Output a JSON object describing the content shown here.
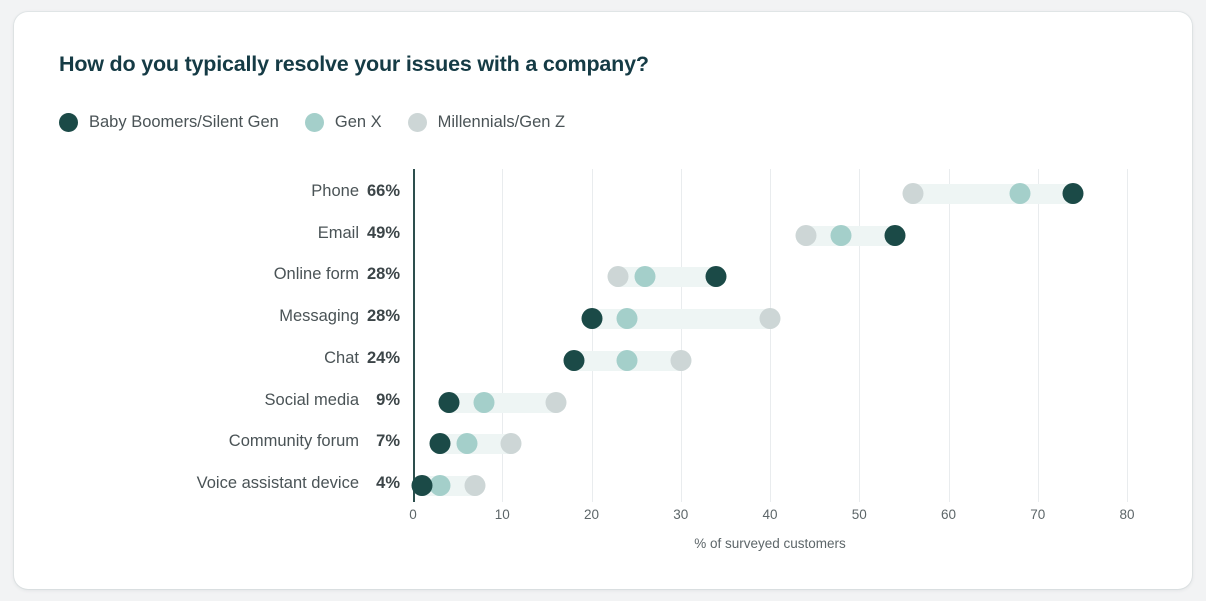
{
  "card": {
    "title": "How do you typically resolve your issues with a company?"
  },
  "legend": {
    "items": [
      {
        "label": "Baby Boomers/Silent Gen",
        "color": "#1b4a47",
        "key": "boomers"
      },
      {
        "label": "Gen X",
        "color": "#a4cfca",
        "key": "genx"
      },
      {
        "label": "Millennials/Gen Z",
        "color": "#cdd6d6",
        "key": "millennials"
      }
    ]
  },
  "colors": {
    "boomers": "#1b4a47",
    "genx": "#a4cfca",
    "millennials": "#cdd6d6",
    "connector": "#eef5f4",
    "gridline": "#e9ecee",
    "axis": "#2d4f4d",
    "title": "#153b45",
    "label": "#4a5356",
    "value": "#3c4548",
    "card_background": "#ffffff",
    "page_background": "#f2f3f4"
  },
  "chart_data": {
    "type": "scatter",
    "subtype": "dumbbell-dot-plot",
    "title": "How do you typically resolve your issues with a company?",
    "xlabel": "% of surveyed customers",
    "ylabel": "",
    "xlim": [
      0,
      80
    ],
    "xticks": [
      0,
      10,
      20,
      30,
      40,
      50,
      60,
      70,
      80
    ],
    "xtick_labels": [
      "0",
      "10",
      "20",
      "30",
      "40",
      "50",
      "60",
      "70",
      "80"
    ],
    "grid": true,
    "legend_position": "top-left",
    "categories": [
      "Phone",
      "Email",
      "Online form",
      "Messaging",
      "Chat",
      "Social media",
      "Community forum",
      "Voice assistant device"
    ],
    "row_values": [
      "66%",
      "49%",
      "28%",
      "28%",
      "24%",
      "9%",
      "7%",
      "4%"
    ],
    "series": [
      {
        "name": "Baby Boomers/Silent Gen",
        "color": "#1b4a47",
        "values": [
          74,
          54,
          34,
          20,
          18,
          4,
          3,
          1
        ]
      },
      {
        "name": "Gen X",
        "color": "#a4cfca",
        "values": [
          68,
          48,
          26,
          24,
          24,
          8,
          6,
          3
        ]
      },
      {
        "name": "Millennials/Gen Z",
        "color": "#cdd6d6",
        "values": [
          56,
          44,
          23,
          40,
          30,
          16,
          11,
          7
        ]
      }
    ],
    "rows": [
      {
        "category": "Phone",
        "value_label": "66%",
        "boomers": 74,
        "genx": 68,
        "millennials": 56
      },
      {
        "category": "Email",
        "value_label": "49%",
        "boomers": 54,
        "genx": 48,
        "millennials": 44
      },
      {
        "category": "Online form",
        "value_label": "28%",
        "boomers": 34,
        "genx": 26,
        "millennials": 23
      },
      {
        "category": "Messaging",
        "value_label": "28%",
        "boomers": 20,
        "genx": 24,
        "millennials": 40
      },
      {
        "category": "Chat",
        "value_label": "24%",
        "boomers": 18,
        "genx": 24,
        "millennials": 30
      },
      {
        "category": "Social media",
        "value_label": "9%",
        "boomers": 4,
        "genx": 8,
        "millennials": 16
      },
      {
        "category": "Community forum",
        "value_label": "7%",
        "boomers": 3,
        "genx": 6,
        "millennials": 11
      },
      {
        "category": "Voice assistant device",
        "value_label": "4%",
        "boomers": 1,
        "genx": 3,
        "millennials": 7
      }
    ]
  }
}
